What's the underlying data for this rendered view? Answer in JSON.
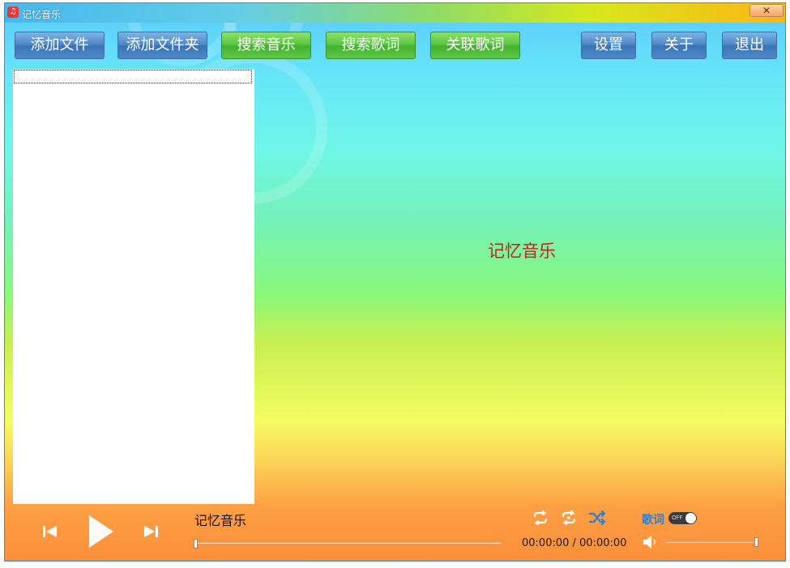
{
  "window": {
    "title": "记忆音乐",
    "close_label": "✕"
  },
  "toolbar": {
    "add_file": "添加文件",
    "add_folder": "添加文件夹",
    "search_music": "搜索音乐",
    "search_lyrics": "搜索歌词",
    "link_lyrics": "关联歌词",
    "settings": "设置",
    "about": "关于",
    "exit": "退出"
  },
  "main": {
    "display_title": "记忆音乐"
  },
  "player": {
    "song_title": "记忆音乐",
    "time": "00:00:00 / 00:00:00",
    "lyrics_label": "歌词",
    "lyrics_toggle": "OFF",
    "progress": 0,
    "volume": 1
  },
  "colors": {
    "accent_blue": "#4d86c6",
    "accent_green": "#58c53e",
    "title_red": "#c81e1e"
  },
  "icons": [
    "music-app-icon",
    "close-icon",
    "previous-icon",
    "play-icon",
    "next-icon",
    "repeat-one-icon",
    "repeat-all-icon",
    "shuffle-icon",
    "volume-icon"
  ]
}
